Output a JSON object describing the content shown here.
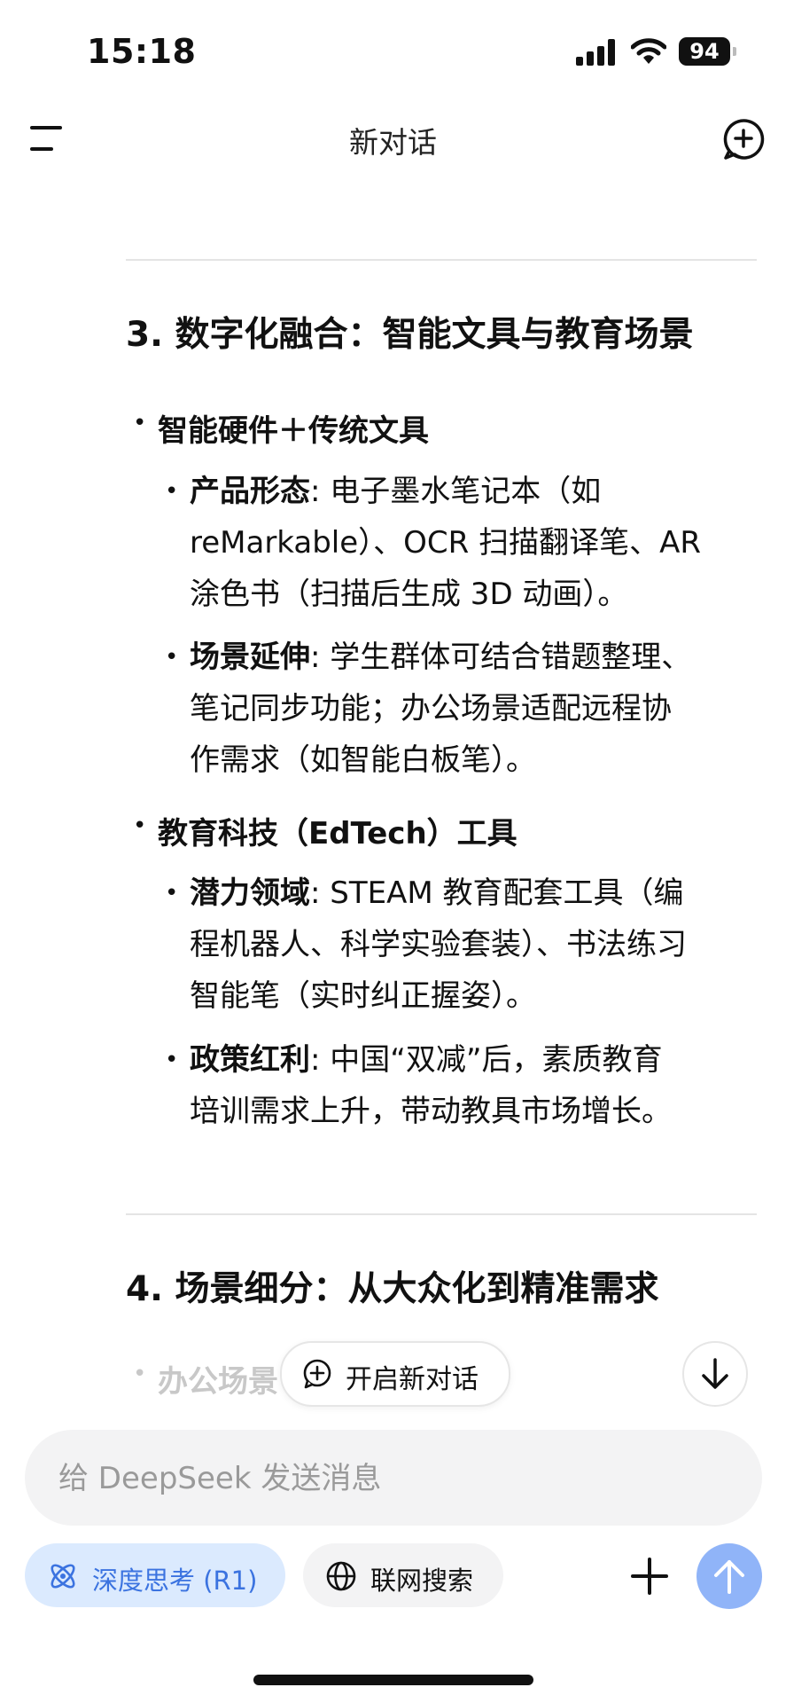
{
  "status": {
    "time": "15:18",
    "battery": "94"
  },
  "header": {
    "title": "新对话"
  },
  "sections": [
    {
      "heading": "3. 数字化融合：智能文具与教育场景",
      "groups": [
        {
          "title": "智能硬件＋传统文具",
          "items": [
            {
              "label": "产品形态",
              "lines": [
                ": 电子墨水笔记本（如",
                "reMarkable）、OCR 扫描翻译笔、AR",
                "涂色书（扫描后生成 3D 动画）。"
              ]
            },
            {
              "label": "场景延伸",
              "lines": [
                ": 学生群体可结合错题整理、",
                "笔记同步功能；办公场景适配远程协",
                "作需求（如智能白板笔）。"
              ]
            }
          ]
        },
        {
          "title": "教育科技（EdTech）工具",
          "items": [
            {
              "label": "潜力领域",
              "lines": [
                ": STEAM 教育配套工具（编",
                "程机器人、科学实验套装）、书法练习",
                "智能笔（实时纠正握姿）。"
              ]
            },
            {
              "label": "政策红利",
              "lines": [
                ": 中国“双减”后，素质教育",
                "培训需求上升，带动教具市场增长。"
              ]
            }
          ]
        }
      ]
    },
    {
      "heading": "4. 场景细分：从大众化到精准需求",
      "partial_item": "办公场景"
    }
  ],
  "floating": {
    "new_chat_label": "开启新对话"
  },
  "composer": {
    "placeholder": "给 DeepSeek 发送消息",
    "deep_think_label": "深度思考 (R1)",
    "web_search_label": "联网搜索"
  },
  "colors": {
    "accent": "#3b73e0",
    "chip_active_bg": "#dbeafe",
    "send_button": "#90b4f8"
  }
}
